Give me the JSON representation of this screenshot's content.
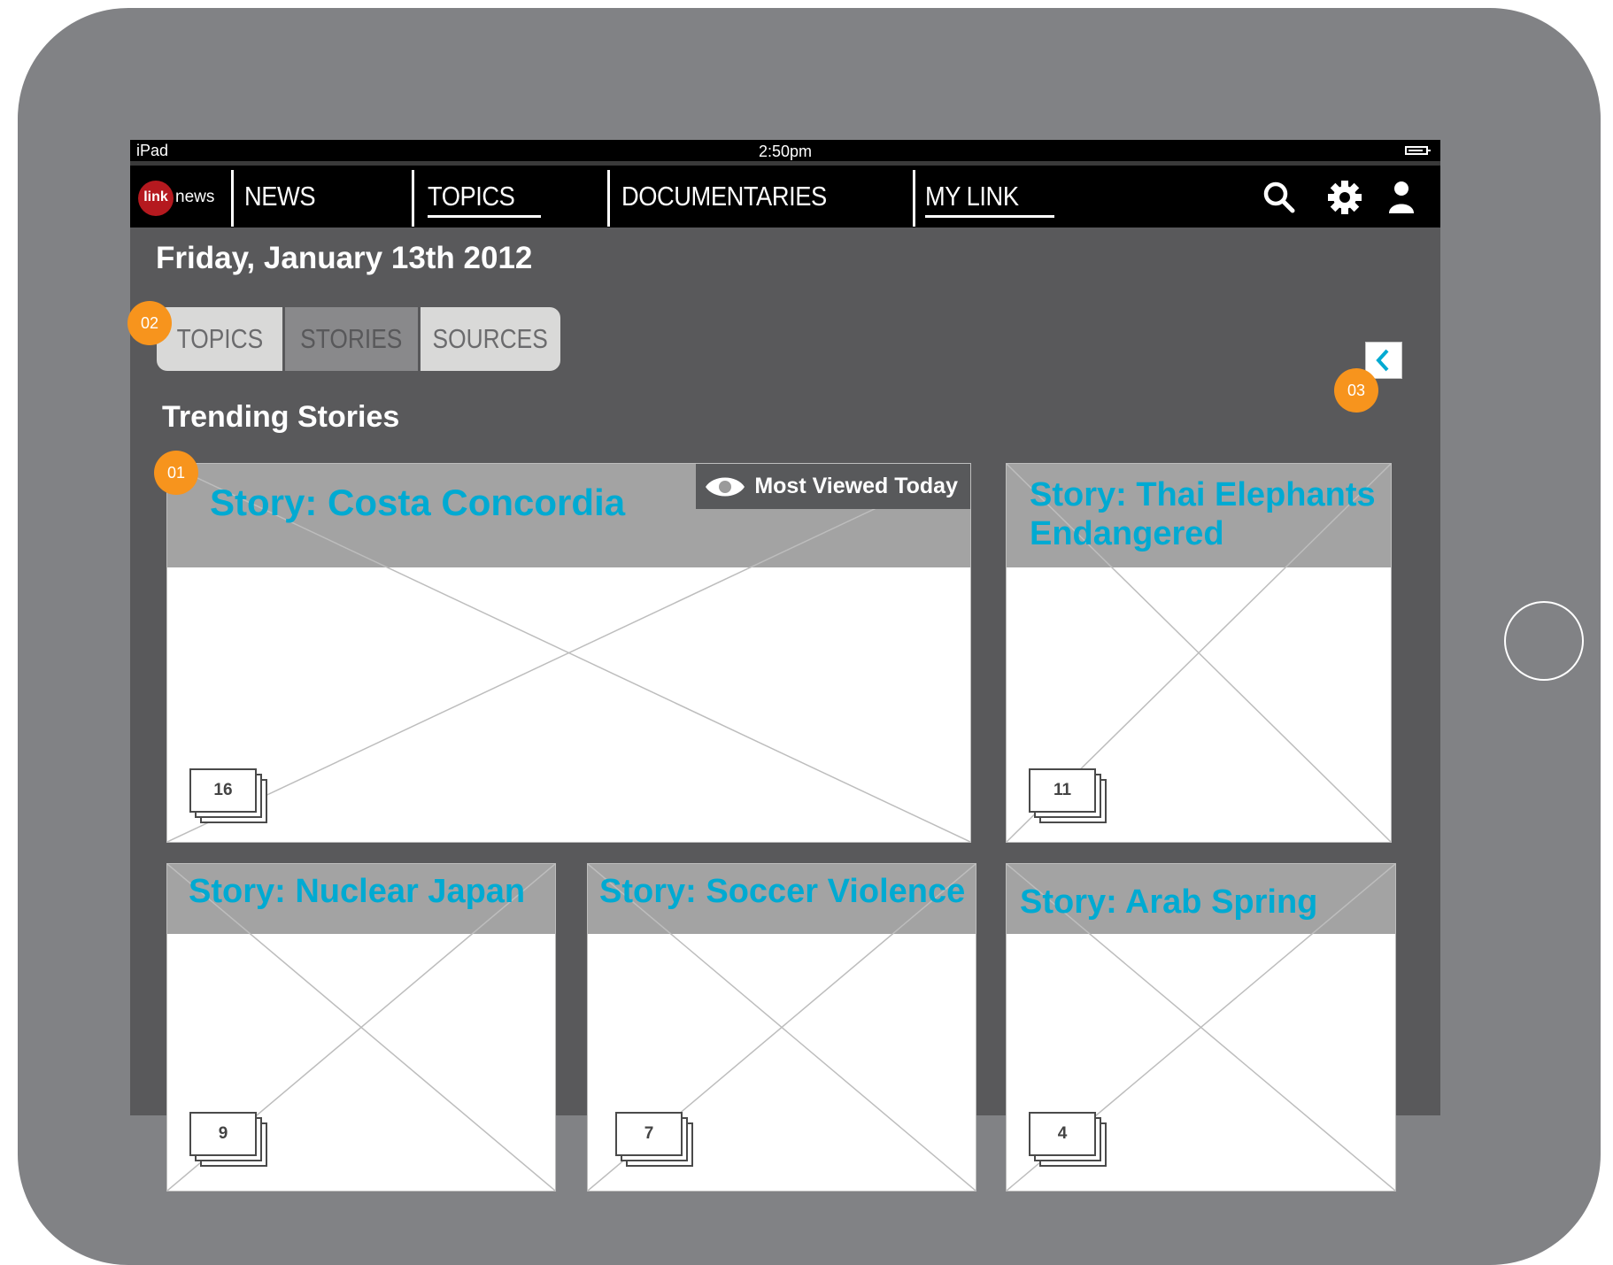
{
  "status_bar": {
    "device": "iPad",
    "time": "2:50pm",
    "battery_icon": "battery-icon"
  },
  "nav": {
    "logo_mark": "link",
    "logo_word": "news",
    "items": [
      {
        "label": "NEWS",
        "underlined": false
      },
      {
        "label": "TOPICS",
        "underlined": true
      },
      {
        "label": "DOCUMENTARIES",
        "underlined": false
      },
      {
        "label": "MY LINK",
        "underlined": true
      }
    ],
    "icons": [
      "search-icon",
      "gear-icon",
      "user-icon"
    ]
  },
  "date": "Friday, January 13th 2012",
  "segmented": {
    "items": [
      "TOPICS",
      "STORIES",
      "SOURCES"
    ],
    "selected": "STORIES"
  },
  "markers": {
    "m1": "01",
    "m2": "02",
    "m3": "03"
  },
  "collapse_icon": "chevron-left-icon",
  "section_title": "Trending Stories",
  "stories": [
    {
      "title": "Story: Costa Concordia",
      "count": "16",
      "badge": "Most Viewed Today"
    },
    {
      "title": "Story: Thai Elephants Endangered",
      "count": "11"
    },
    {
      "title": "Story: Nuclear Japan",
      "count": "9"
    },
    {
      "title": "Story: Soccer Violence",
      "count": "7"
    },
    {
      "title": "Story: Arab Spring",
      "count": "4"
    }
  ],
  "colors": {
    "device_frame": "#818285",
    "screen_bg": "#59595b",
    "accent_title": "#00aad2",
    "marker": "#f7941d",
    "logo_red": "#b5191f"
  }
}
